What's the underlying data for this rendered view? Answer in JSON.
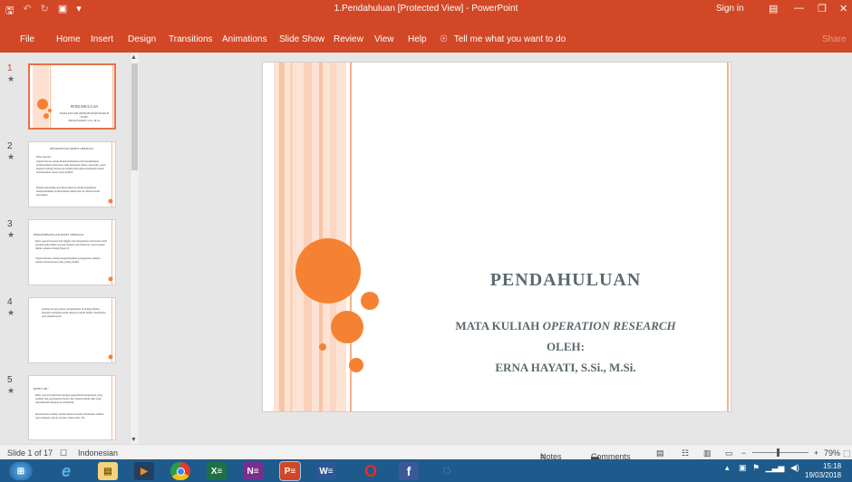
{
  "window": {
    "title": "1.Pendahuluan [Protected View] - PowerPoint",
    "sign_in": "Sign in",
    "share": "Share"
  },
  "ribbon": {
    "tabs": [
      "File",
      "Home",
      "Insert",
      "Design",
      "Transitions",
      "Animations",
      "Slide Show",
      "Review",
      "View",
      "Help"
    ],
    "tell_me": "Tell me what you want to do"
  },
  "thumbnails": [
    {
      "number": "1",
      "title": "PENDAHULUAN",
      "lines": [
        "MATA KULIAH OPERATION RESEARCH",
        "OLEH:",
        "ERNA HAYATI, S.Si., M.Si."
      ]
    },
    {
      "number": "2",
      "title": "PENGERTIAN RISET OPERASI",
      "lines": [
        "Riset Operasi",
        "adalah metode untuk memformulasikan dan merumuskan permasalahan sehari-hari baik mengenai bisnis, ekonomi, sosial maupun bidang lainnya ke dalam pemodelan matematis untuk mendapatkan solusi yang optimal.",
        "Bagian terpenting dari Riset Operasi adalah bagaimana menerjemahkan permasalahan sehari-hari ke dalam model matematis."
      ]
    },
    {
      "number": "3",
      "title": "PERKEMBANGAN RISET OPERASI",
      "lines": [
        "Riset operasi berasal dari Inggris dan merupakan suatu hasil studi sebuah team militer terpadu dengan para ilmuwan sosial sejenis militer selama Perang Dunia II.",
        "Tujuan mereka adalah mengalokasikan penggunaan sumber-sumber keterbatasan yang paling efektif."
      ]
    },
    {
      "number": "4",
      "title": "",
      "lines": [
        "Setelah perang selesai, keberhasilan di bidang militer menarik perhatian kaum ilmuwan untuk militer. Kemudian para industriawan."
      ]
    },
    {
      "number": "5",
      "title": "RISET OR :",
      "lines": [
        "Riset operasi berkenaan dengan pengambilan keputusan yang optimal dan penyusunan model dari sistem-sistem baik yang deterministik maupun probabilistik.",
        "Keterbatasan sumber dalam analisa tersebut ditentukan sumber daya manusia, mesin, modal, bahan baku, dll."
      ]
    }
  ],
  "slide": {
    "title": "PENDAHULUAN",
    "subtitle_line1_a": "MATA KULIAH ",
    "subtitle_line1_b": "OPERATION RESEARCH",
    "subtitle_line2": "OLEH:",
    "subtitle_line3": "ERNA HAYATI, S.Si., M.Si."
  },
  "status": {
    "slide_of": "Slide 1 of 17",
    "language": "Indonesian",
    "notes": "Notes",
    "comments": "Comments",
    "zoom": "79%"
  },
  "clock": {
    "time": "15:18",
    "date": "19/03/2018"
  },
  "colors": {
    "accent": "#d24726",
    "slide_orange": "#f58233",
    "slide_text": "#5a6a6e",
    "taskbar": "#1e5b8c"
  },
  "icons": [
    "save-icon",
    "undo-icon",
    "redo-icon",
    "start-presenting-icon",
    "lightbulb-icon",
    "windows-start-icon",
    "ie-icon",
    "explorer-icon",
    "media-icon",
    "chrome-icon",
    "excel-icon",
    "onenote-icon",
    "powerpoint-icon",
    "word-icon",
    "opera-icon",
    "facebook-icon"
  ]
}
